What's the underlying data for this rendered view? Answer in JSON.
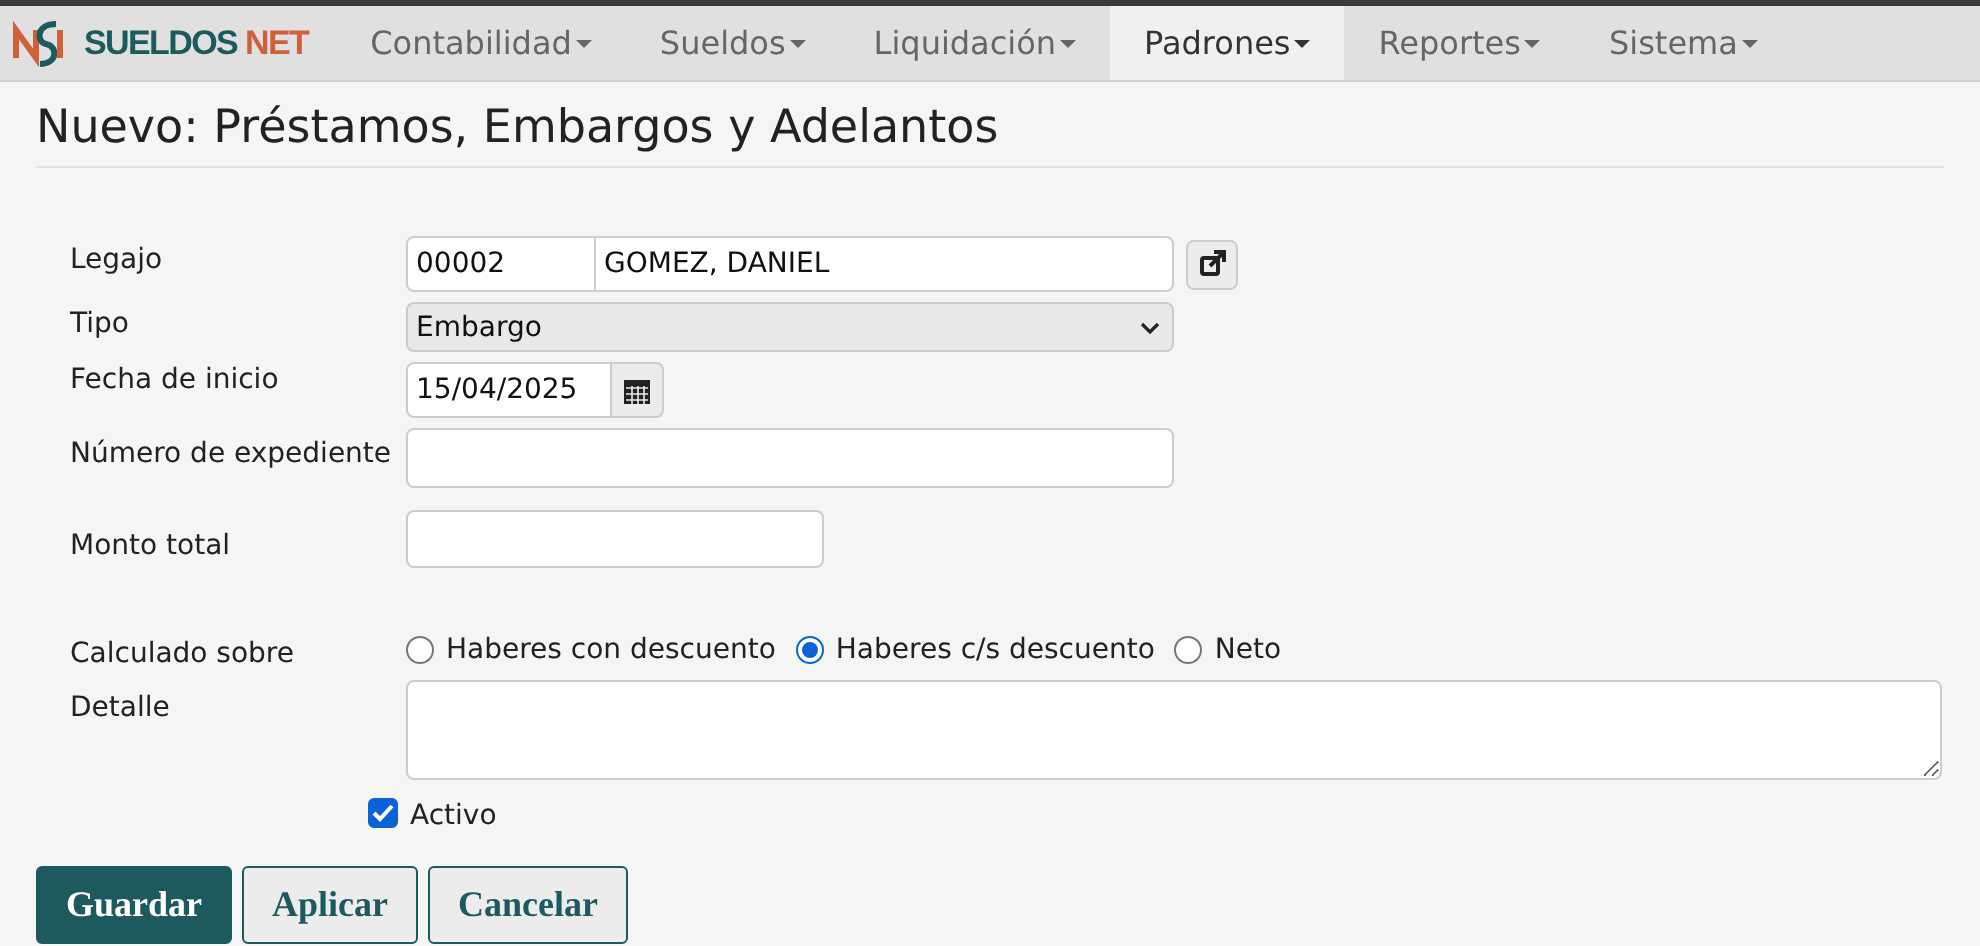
{
  "logo": {
    "primary": "SUELDOS",
    "accent": "NET"
  },
  "menu": [
    {
      "label": "Contabilidad",
      "selected": false
    },
    {
      "label": "Sueldos",
      "selected": false
    },
    {
      "label": "Liquidación",
      "selected": false
    },
    {
      "label": "Padrones",
      "selected": true
    },
    {
      "label": "Reportes",
      "selected": false
    },
    {
      "label": "Sistema",
      "selected": false
    }
  ],
  "page_title": "Nuevo: Préstamos, Embargos y Adelantos",
  "form": {
    "legajo": {
      "label": "Legajo",
      "code": "00002",
      "name": "GOMEZ, DANIEL"
    },
    "tipo": {
      "label": "Tipo",
      "value": "Embargo"
    },
    "fecha_inicio": {
      "label": "Fecha de inicio",
      "value": "15/04/2025"
    },
    "numero_expediente": {
      "label": "Número de expediente"
    },
    "monto_total": {
      "label": "Monto total"
    },
    "calculado_sobre": {
      "label": "Calculado sobre",
      "options": [
        {
          "label": "Haberes con descuento",
          "selected": false
        },
        {
          "label": "Haberes c/s descuento",
          "selected": true
        },
        {
          "label": "Neto",
          "selected": false
        }
      ]
    },
    "detalle": {
      "label": "Detalle"
    },
    "activo": {
      "label": "Activo",
      "checked": true
    }
  },
  "buttons": [
    {
      "label": "Guardar",
      "kind": "primary"
    },
    {
      "label": "Aplicar",
      "kind": "secondary"
    },
    {
      "label": "Cancelar",
      "kind": "secondary"
    }
  ]
}
